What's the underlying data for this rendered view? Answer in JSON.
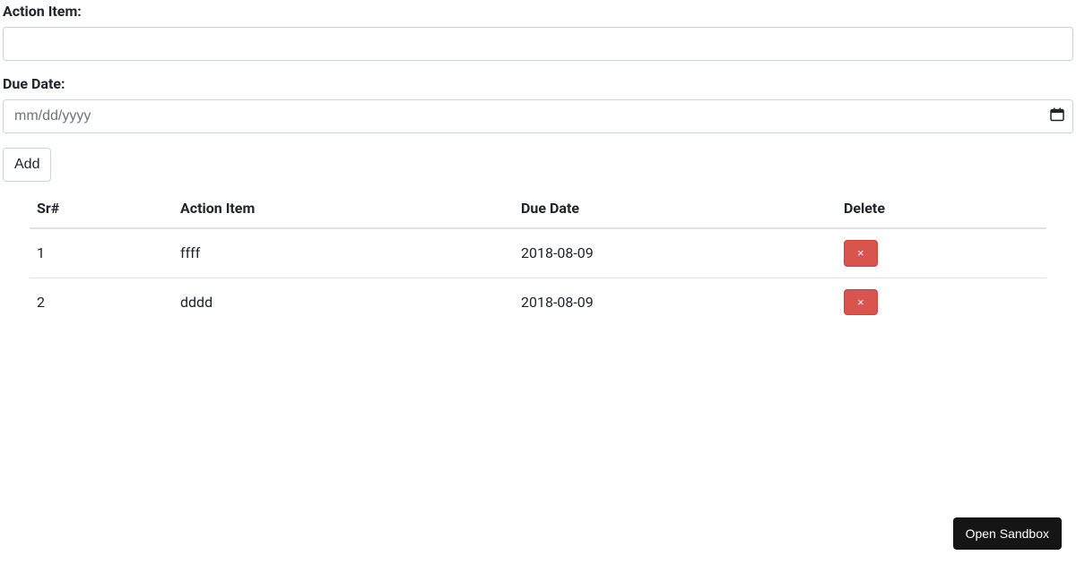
{
  "form": {
    "actionItemLabel": "Action Item:",
    "actionItemValue": "",
    "dueDateLabel": "Due Date:",
    "dueDatePlaceholder": "mm/dd/yyyy",
    "dueDateValue": "",
    "addButtonLabel": "Add"
  },
  "table": {
    "headers": {
      "sr": "Sr#",
      "actionItem": "Action Item",
      "dueDate": "Due Date",
      "delete": "Delete"
    },
    "rows": [
      {
        "sr": "1",
        "actionItem": "ffff",
        "dueDate": "2018-08-09",
        "deleteIcon": "×"
      },
      {
        "sr": "2",
        "actionItem": "dddd",
        "dueDate": "2018-08-09",
        "deleteIcon": "×"
      }
    ]
  },
  "footer": {
    "openSandbox": "Open Sandbox"
  }
}
